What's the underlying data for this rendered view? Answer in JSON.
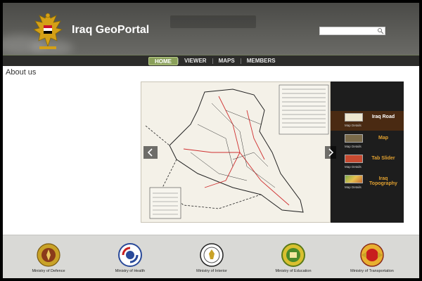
{
  "header": {
    "title": "Iraq GeoPortal",
    "search_placeholder": ""
  },
  "nav": {
    "items": [
      "HOME",
      "VIEWER",
      "MAPS",
      "MEMBERS"
    ],
    "active_index": 0
  },
  "about": {
    "title": "About us"
  },
  "slider": {
    "items": [
      {
        "title": "Iraq Road",
        "details": "Map Details",
        "active": true
      },
      {
        "title": "Map",
        "details": "Map Details",
        "active": false
      },
      {
        "title": "Tab Slider",
        "details": "Map Details",
        "active": false
      },
      {
        "title": "Iraq Topography",
        "details": "Map Details",
        "active": false
      }
    ]
  },
  "ministries": [
    {
      "name": "Ministry of Defence"
    },
    {
      "name": "Ministry of Health"
    },
    {
      "name": "Ministry of Interior"
    },
    {
      "name": "Ministry of Education"
    },
    {
      "name": "Ministry of Transportation"
    }
  ],
  "colors": {
    "header_bg": "#5c5c58",
    "nav_bg": "#2c2c2a",
    "nav_active": "#8aa05a",
    "thumb_panel": "#1d1d1d",
    "thumb_active": "#4a2a12",
    "thumb_title": "#e0a030",
    "footer_bg": "#d9d9d6"
  },
  "icons": {
    "emblem": "eagle-emblem-icon",
    "search": "search-icon",
    "prev": "chevron-left-icon",
    "next": "chevron-right-icon"
  }
}
